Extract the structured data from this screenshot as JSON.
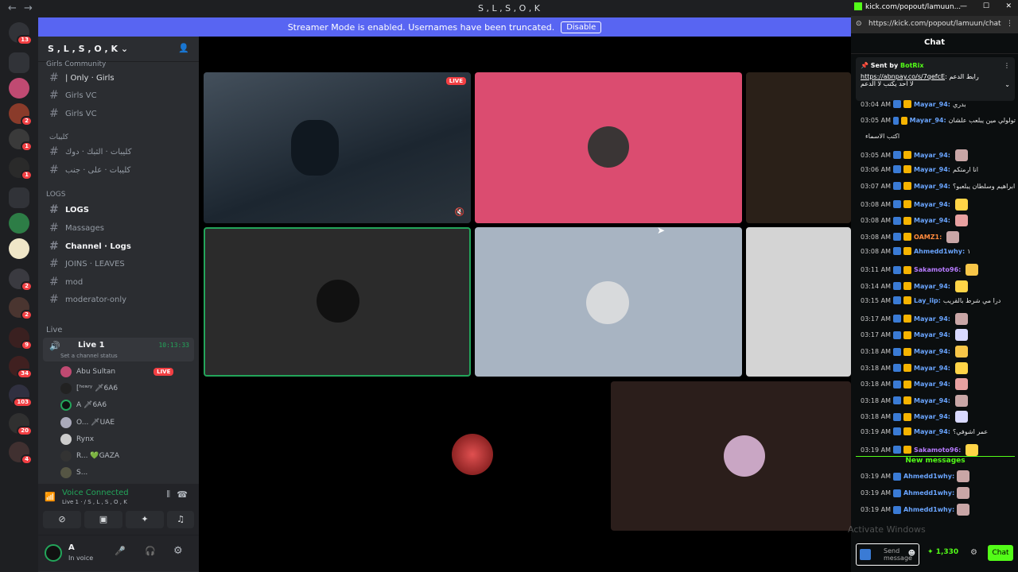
{
  "window": {
    "title": "S , L , S , O , K"
  },
  "banner": {
    "text": "Streamer Mode is enabled. Usernames have been truncated.",
    "button": "Disable"
  },
  "servers": {
    "badges": [
      "13",
      "2",
      "1",
      "1",
      "2",
      "2",
      "9",
      "34",
      "103",
      "20",
      "4"
    ]
  },
  "sidebar": {
    "server_name": "S , L , S , O , K",
    "categories": {
      "girls": "Girls Community",
      "kit": "كليبات",
      "logs": "LOGS",
      "live": "Live"
    },
    "channels": {
      "only_girls": "| Only · Girls",
      "girls_vc": "Girls VC",
      "girls_vc2": "Girls VC",
      "kit1": "كليبات · الثبك · دوك",
      "kit2": "كليبات · على · جنب",
      "logs": "LOGS",
      "massages": "Massages",
      "channel_logs": "Channel · Logs",
      "joins": "JOINS · LEAVES",
      "mod": "mod",
      "moderator": "moderator-only"
    },
    "voice": {
      "channel": "Live 1",
      "timer": "10:13:33",
      "status": "Set a channel status",
      "users": [
        {
          "name": "Abu Sultan",
          "live": "LIVE"
        },
        {
          "name": "[ʰᵉᶰʳʸ 🗡6A6"
        },
        {
          "name": "A 🗡6A6"
        },
        {
          "name": "O... 🗡UAE"
        },
        {
          "name": "Rynx"
        },
        {
          "name": "R... 💚GAZA"
        },
        {
          "name": "S..."
        }
      ]
    },
    "panel": {
      "connected": "Voice Connected",
      "channel_path": "Live 1 · / S , L , S , O , K",
      "user": "A",
      "user_status": "In voice"
    }
  },
  "stage": {
    "live_badge": "LIVE"
  },
  "chat": {
    "window_title": "kick.com/popout/lamuun...",
    "url": "https://kick.com/popout/lamuun/chat",
    "header": "Chat",
    "pinned": {
      "sent_by": "Sent by",
      "bot": "BotRix",
      "text_link": "https://abnpay.co/s/7qefcE",
      "text": ": رابط الدعم",
      "text2": "لا احد يكتب لا الدعم"
    },
    "messages": [
      {
        "time": "03:04 AM",
        "user": "Mayar_94:",
        "text": "بدري"
      },
      {
        "time": "03:05 AM",
        "user": "Mayar_94:",
        "text": "تولولي مين يبلعب علشان"
      },
      {
        "time": "",
        "user": "",
        "text": "اكتب الاسماء"
      },
      {
        "time": "03:05 AM",
        "user": "Mayar_94:",
        "text": ""
      },
      {
        "time": "03:06 AM",
        "user": "Mayar_94:",
        "text": "انا ارمتكم"
      },
      {
        "time": "03:07 AM",
        "user": "Mayar_94:",
        "text": "ابراهيم وسلطان يبلعبو؟"
      },
      {
        "time": "03:08 AM",
        "user": "Mayar_94:",
        "text": ""
      },
      {
        "time": "03:08 AM",
        "user": "Mayar_94:",
        "text": ""
      },
      {
        "time": "03:08 AM",
        "user": "OAMZ1:",
        "text": ""
      },
      {
        "time": "03:08 AM",
        "user": "Ahmedd1why:",
        "text": "١"
      },
      {
        "time": "03:11 AM",
        "user": "Sakamoto96:",
        "text": ""
      },
      {
        "time": "03:14 AM",
        "user": "Mayar_94:",
        "text": ""
      },
      {
        "time": "03:15 AM",
        "user": "Lay_iip:",
        "text": "درا مي شرط بالقريب"
      },
      {
        "time": "03:17 AM",
        "user": "Mayar_94:",
        "text": ""
      },
      {
        "time": "03:17 AM",
        "user": "Mayar_94:",
        "text": ""
      },
      {
        "time": "03:18 AM",
        "user": "Mayar_94:",
        "text": ""
      },
      {
        "time": "03:18 AM",
        "user": "Mayar_94:",
        "text": ""
      },
      {
        "time": "03:18 AM",
        "user": "Mayar_94:",
        "text": ""
      },
      {
        "time": "03:18 AM",
        "user": "Mayar_94:",
        "text": ""
      },
      {
        "time": "03:18 AM",
        "user": "Mayar_94:",
        "text": ""
      },
      {
        "time": "03:19 AM",
        "user": "Mayar_94:",
        "text": "عمر اشوفي؟"
      },
      {
        "time": "03:19 AM",
        "user": "Sakamoto96:",
        "text": ""
      }
    ],
    "new_messages": "New messages",
    "new": [
      {
        "time": "03:19 AM",
        "user": "Ahmedd1why:"
      },
      {
        "time": "03:19 AM",
        "user": "Ahmedd1why:"
      },
      {
        "time": "03:19 AM",
        "user": "Ahmedd1why:"
      }
    ],
    "input_placeholder": "Send message",
    "points": "1,330",
    "send": "Chat",
    "watermark": "Activate Windows"
  }
}
